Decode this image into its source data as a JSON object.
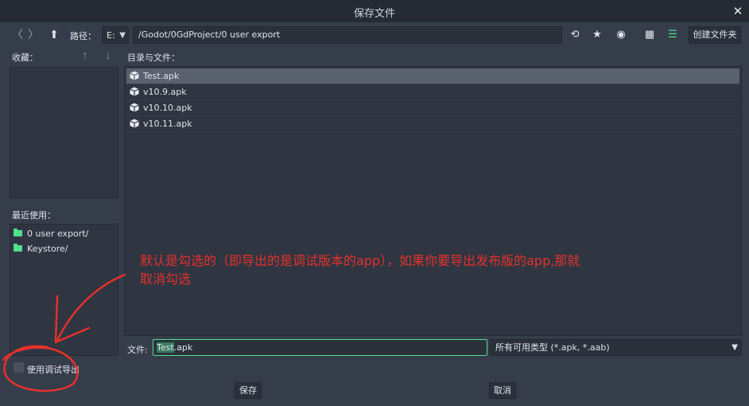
{
  "window": {
    "title": "保存文件",
    "close_glyph": "✕"
  },
  "toolbar": {
    "back_glyph": "〈",
    "forward_glyph": "〉",
    "up_glyph": "⬆",
    "path_label": "路径：",
    "drive": "E:",
    "path": "/Godot/0GdProject/0 user export",
    "refresh_glyph": "⟲",
    "favorite_glyph": "★",
    "hidden_glyph": "◉",
    "grid_glyph": "▦",
    "list_glyph": "☰",
    "mkdir_label": "创建文件夹"
  },
  "favorites": {
    "label": "收藏：",
    "up_glyph": "⭡",
    "down_glyph": "⭣"
  },
  "recent": {
    "label": "最近使用：",
    "items": [
      "0 user export/",
      "Keystore/"
    ]
  },
  "files": {
    "label": "目录与文件：",
    "items": [
      "Test.apk",
      "v10.9.apk",
      "v10.10.apk",
      "v10.11.apk"
    ],
    "selected": "Test.apk"
  },
  "footer": {
    "file_label": "文件:",
    "filename_highlight": "Test",
    "filename_rest": ".apk",
    "filter": "所有可用类型 (*.apk, *.aab)",
    "debug_export_label": "使用调试导出",
    "save_label": "保存",
    "cancel_label": "取消"
  },
  "annotation": {
    "line1": "默认是勾选的（即导出的是调试版本的app），如果你要导出发布版的app,那就",
    "line2": "取消勾选",
    "color": "#e5312c"
  },
  "colors": {
    "accent": "#4ee08e",
    "background": "#363d4a",
    "titlebar": "#262b33"
  }
}
